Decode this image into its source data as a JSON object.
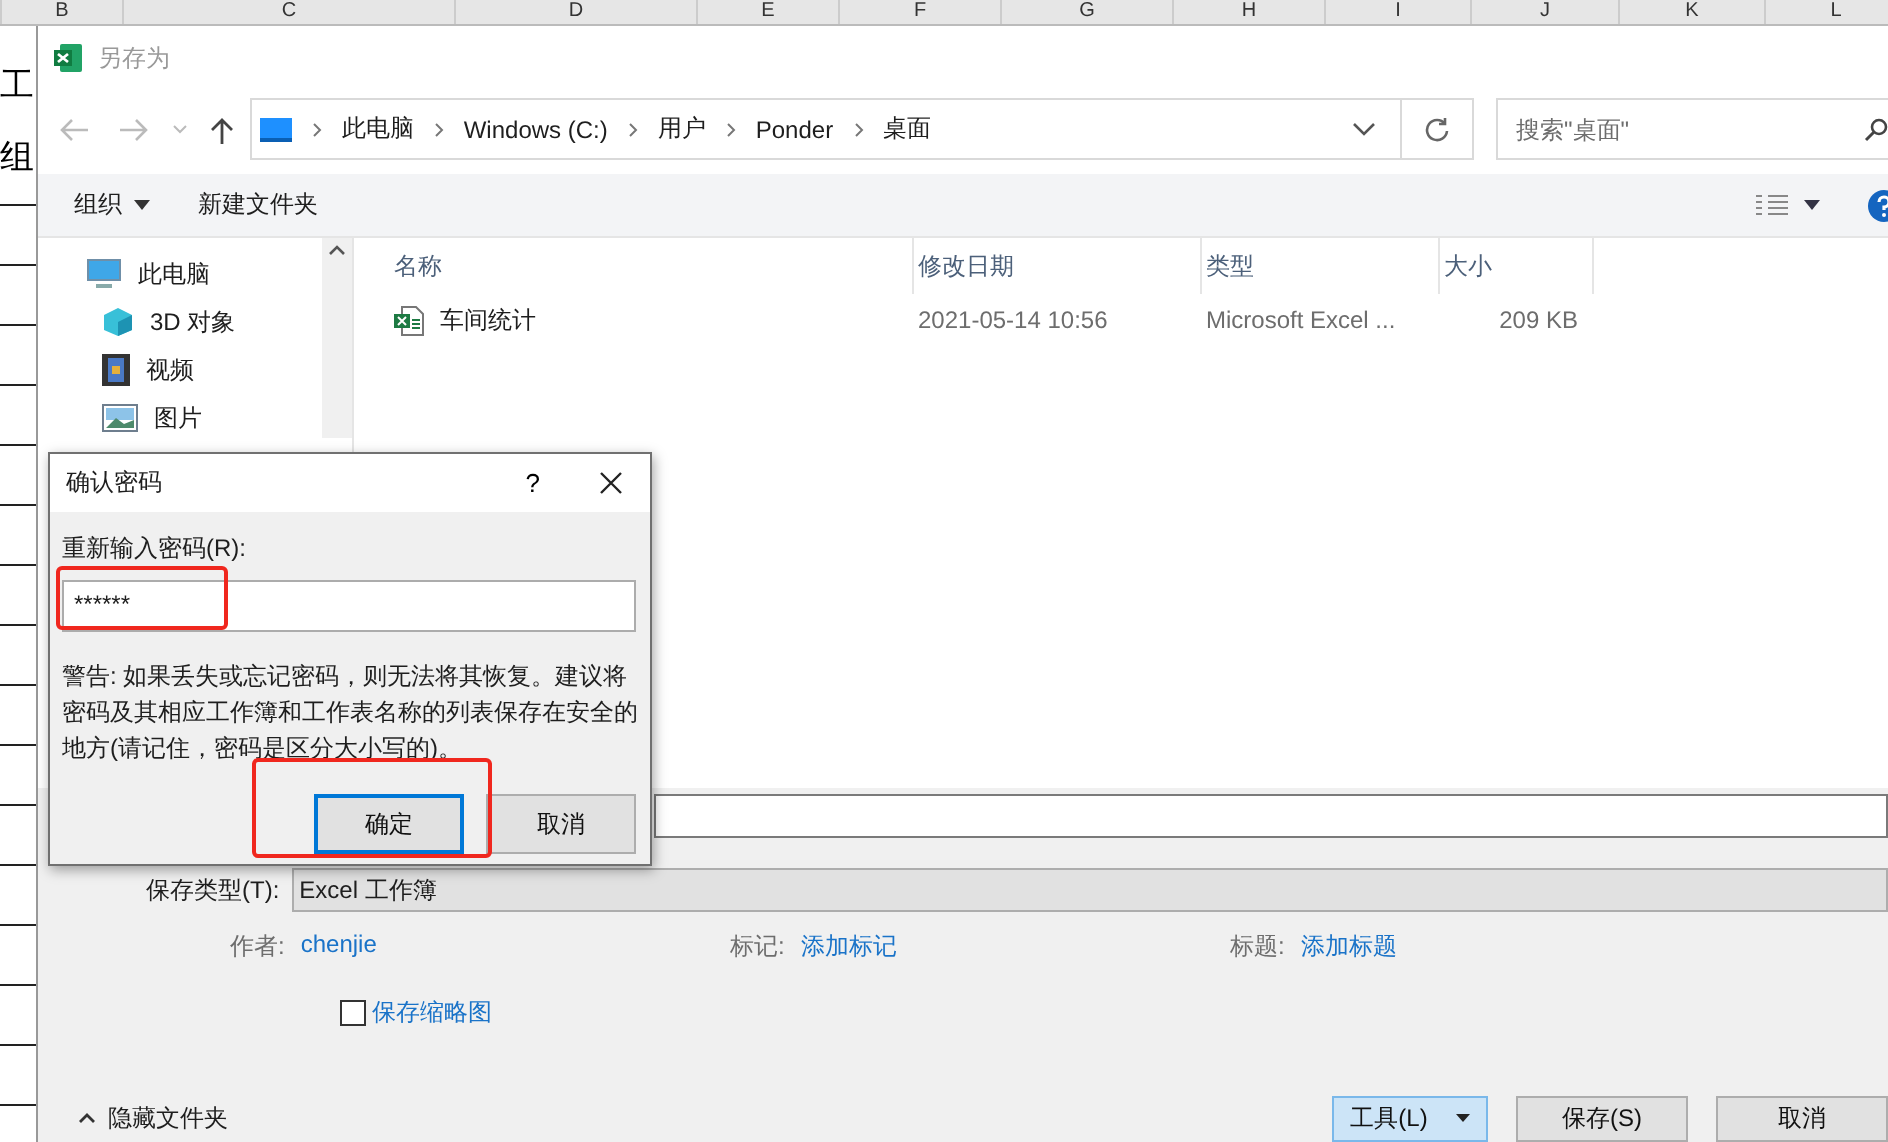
{
  "spreadsheet": {
    "column_headers": [
      "B",
      "C",
      "D",
      "E",
      "F",
      "G",
      "H",
      "I",
      "J",
      "K",
      "L"
    ],
    "row_labels": [
      "工",
      "组"
    ]
  },
  "save_dialog": {
    "title": "另存为",
    "breadcrumb": [
      "此电脑",
      "Windows (C:)",
      "用户",
      "Ponder",
      "桌面"
    ],
    "search": {
      "placeholder": "搜索\"桌面\""
    },
    "toolbar": {
      "organize": "组织",
      "new_folder": "新建文件夹"
    },
    "nav_pane": [
      {
        "label": "此电脑",
        "kind": "computer"
      },
      {
        "label": "3D 对象",
        "kind": "objects3d"
      },
      {
        "label": "视频",
        "kind": "video"
      },
      {
        "label": "图片",
        "kind": "pictures"
      }
    ],
    "file_list": {
      "columns": [
        "名称",
        "修改日期",
        "类型",
        "大小"
      ],
      "rows": [
        {
          "name": "车间统计",
          "modified": "2021-05-14 10:56",
          "type": "Microsoft Excel ...",
          "size": "209 KB"
        }
      ]
    },
    "save_type": {
      "label": "保存类型(T):",
      "value": "Excel 工作簿"
    },
    "metadata": [
      {
        "label": "作者:",
        "value": "chenjie"
      },
      {
        "label": "标记:",
        "value": "添加标记"
      },
      {
        "label": "标题:",
        "value": "添加标题"
      }
    ],
    "thumbnail_checkbox": {
      "label": "保存缩略图",
      "checked": false
    },
    "hide_folders": "隐藏文件夹",
    "buttons": [
      {
        "label": "工具(L)",
        "kind": "menu",
        "focused": true
      },
      {
        "label": "保存(S)",
        "kind": "plain",
        "focused": false
      },
      {
        "label": "取消",
        "kind": "plain",
        "focused": false
      }
    ]
  },
  "password_dialog": {
    "title": "确认密码",
    "help": "?",
    "label": "重新输入密码(R):",
    "value": "******",
    "field_highlighted": true,
    "warning": "警告: 如果丢失或忘记密码，则无法将其恢复。建议将密码及其相应工作簿和工作表名称的列表保存在安全的地方(请记住，密码是区分大小写的)。",
    "buttons": [
      {
        "label": "确定",
        "default": true,
        "highlighted": true
      },
      {
        "label": "取消",
        "default": false,
        "highlighted": false
      }
    ]
  }
}
